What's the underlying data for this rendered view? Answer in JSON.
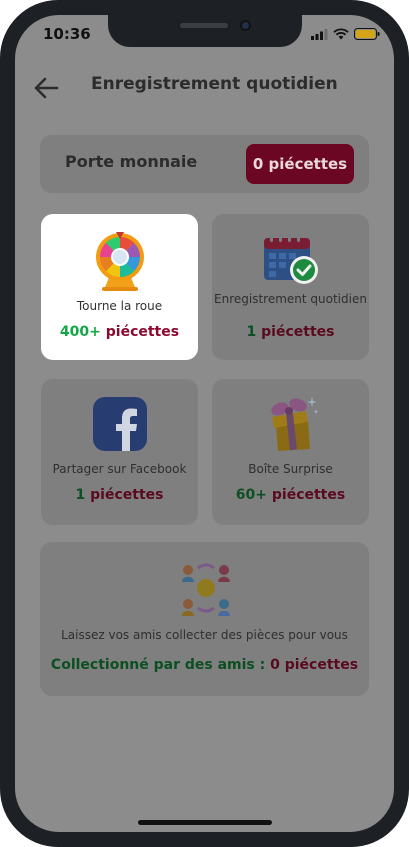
{
  "status_bar": {
    "time": "10:36"
  },
  "header": {
    "title": "Enregistrement quotidien"
  },
  "wallet": {
    "label": "Porte monnaie",
    "balance": "0 piécettes"
  },
  "tiles": [
    {
      "label": "Tourne la roue",
      "amount": "400+",
      "unit": "piécettes"
    },
    {
      "label": "Enregistrement quotidien",
      "amount": "1",
      "unit": "piécettes"
    },
    {
      "label": "Partager sur Facebook",
      "amount": "1",
      "unit": "piécettes"
    },
    {
      "label": "Boîte Surprise",
      "amount": "60+",
      "unit": "piécettes"
    }
  ],
  "friends": {
    "label": "Laissez vos amis collecter des pièces pour vous",
    "collected_prefix": "Collectionné par des amis : ",
    "collected_amount": "0",
    "unit": "piécettes"
  },
  "icons": [
    "back-arrow-icon",
    "prize-wheel-icon",
    "calendar-check-icon",
    "facebook-icon",
    "gift-box-icon",
    "friends-circle-icon"
  ],
  "colors": {
    "accent": "#6b0722",
    "green": "#12a847",
    "maroon": "#8a0a30"
  }
}
